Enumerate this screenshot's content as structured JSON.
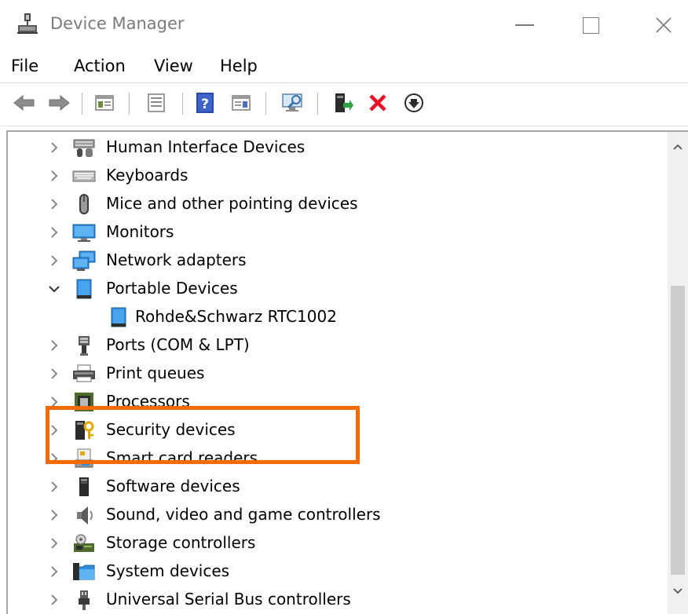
{
  "window": {
    "title": "Device Manager"
  },
  "menu": {
    "file": "File",
    "action": "Action",
    "view": "View",
    "help": "Help"
  },
  "toolbar": {
    "icons": [
      "back-icon",
      "forward-icon",
      "show-hide-console-tree-icon",
      "properties-icon",
      "help-icon",
      "action-pane-icon",
      "scan-hardware-changes-icon",
      "update-driver-icon",
      "uninstall-device-icon",
      "disable-device-icon"
    ]
  },
  "tree": {
    "items": [
      {
        "label": "Human Interface Devices",
        "icon": "human-interface-icon",
        "expanded": false
      },
      {
        "label": "Keyboards",
        "icon": "keyboard-icon",
        "expanded": false
      },
      {
        "label": "Mice and other pointing devices",
        "icon": "mouse-icon",
        "expanded": false
      },
      {
        "label": "Monitors",
        "icon": "monitor-icon",
        "expanded": false
      },
      {
        "label": "Network adapters",
        "icon": "network-adapter-icon",
        "expanded": false
      },
      {
        "label": "Portable Devices",
        "icon": "portable-device-icon",
        "expanded": true
      },
      {
        "label": "Rohde&Schwarz RTC1002",
        "icon": "portable-device-icon",
        "child": true
      },
      {
        "label": "Ports (COM & LPT)",
        "icon": "port-icon",
        "expanded": false
      },
      {
        "label": "Print queues",
        "icon": "printer-icon",
        "expanded": false
      },
      {
        "label": "Processors",
        "icon": "processor-icon",
        "expanded": false
      },
      {
        "label": "Security devices",
        "icon": "security-icon",
        "expanded": false
      },
      {
        "label": "Smart card readers",
        "icon": "smart-card-icon",
        "expanded": false
      },
      {
        "label": "Software devices",
        "icon": "software-device-icon",
        "expanded": false
      },
      {
        "label": "Sound, video and game controllers",
        "icon": "sound-icon",
        "expanded": false
      },
      {
        "label": "Storage controllers",
        "icon": "storage-icon",
        "expanded": false
      },
      {
        "label": "System devices",
        "icon": "system-icon",
        "expanded": false
      },
      {
        "label": "Universal Serial Bus controllers",
        "icon": "usb-icon",
        "expanded": false
      }
    ]
  },
  "colors": {
    "highlight": "#f56b00",
    "accent_blue": "#1e88e5"
  }
}
